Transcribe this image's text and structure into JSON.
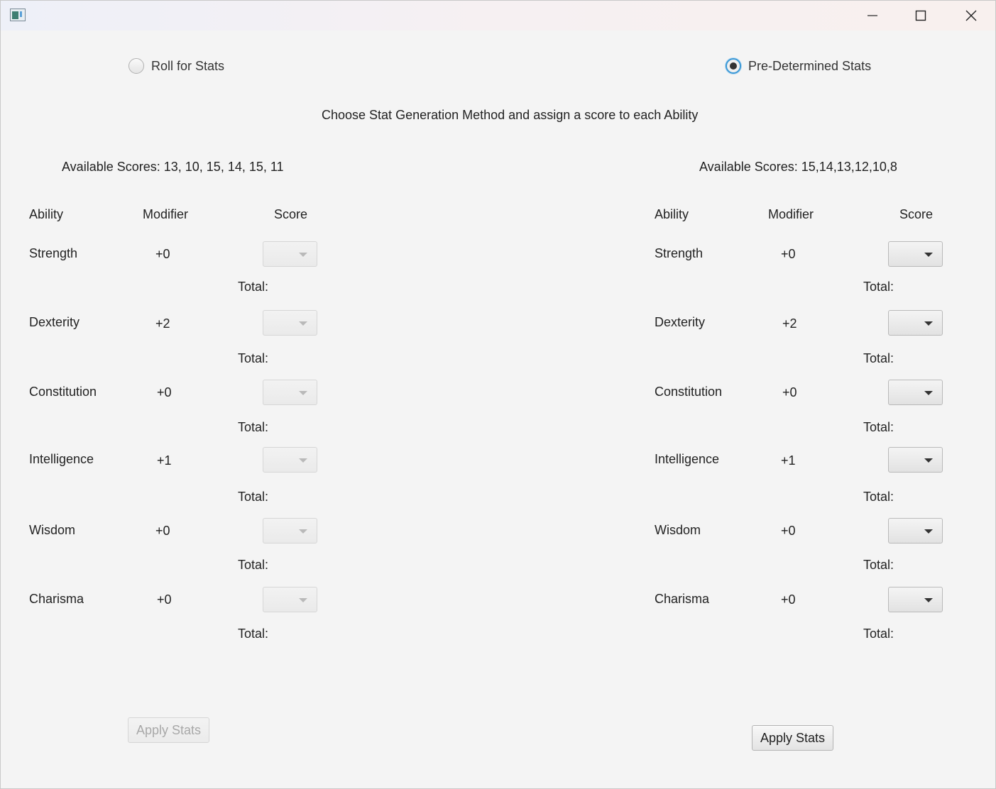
{
  "window": {
    "minimize_icon": "minimize-icon",
    "maximize_icon": "maximize-icon",
    "close_icon": "close-icon"
  },
  "methods": {
    "roll": {
      "label": "Roll for Stats",
      "selected": false
    },
    "predetermined": {
      "label": "Pre-Determined Stats",
      "selected": true
    }
  },
  "instructions": "Choose Stat Generation Method and assign a score to each Ability",
  "left_panel": {
    "available": "Available Scores: 13, 10, 15, 14, 15, 11",
    "headers": {
      "ability": "Ability",
      "modifier": "Modifier",
      "score": "Score"
    },
    "enabled": false,
    "rows": [
      {
        "ability": "Strength",
        "modifier": "+0",
        "total": "Total:"
      },
      {
        "ability": "Dexterity",
        "modifier": "+2",
        "total": "Total:"
      },
      {
        "ability": "Constitution",
        "modifier": "+0",
        "total": "Total:"
      },
      {
        "ability": "Intelligence",
        "modifier": "+1",
        "total": "Total:"
      },
      {
        "ability": "Wisdom",
        "modifier": "+0",
        "total": "Total:"
      },
      {
        "ability": "Charisma",
        "modifier": "+0",
        "total": "Total:"
      }
    ],
    "apply_label": "Apply Stats"
  },
  "right_panel": {
    "available": "Available Scores: 15,14,13,12,10,8",
    "headers": {
      "ability": "Ability",
      "modifier": "Modifier",
      "score": "Score"
    },
    "enabled": true,
    "rows": [
      {
        "ability": "Strength",
        "modifier": "+0",
        "total": "Total:"
      },
      {
        "ability": "Dexterity",
        "modifier": "+2",
        "total": "Total:"
      },
      {
        "ability": "Constitution",
        "modifier": "+0",
        "total": "Total:"
      },
      {
        "ability": "Intelligence",
        "modifier": "+1",
        "total": "Total:"
      },
      {
        "ability": "Wisdom",
        "modifier": "+0",
        "total": "Total:"
      },
      {
        "ability": "Charisma",
        "modifier": "+0",
        "total": "Total:"
      }
    ],
    "apply_label": "Apply Stats"
  },
  "colors": {
    "accent": "#3a98d6",
    "background": "#f4f4f4"
  }
}
